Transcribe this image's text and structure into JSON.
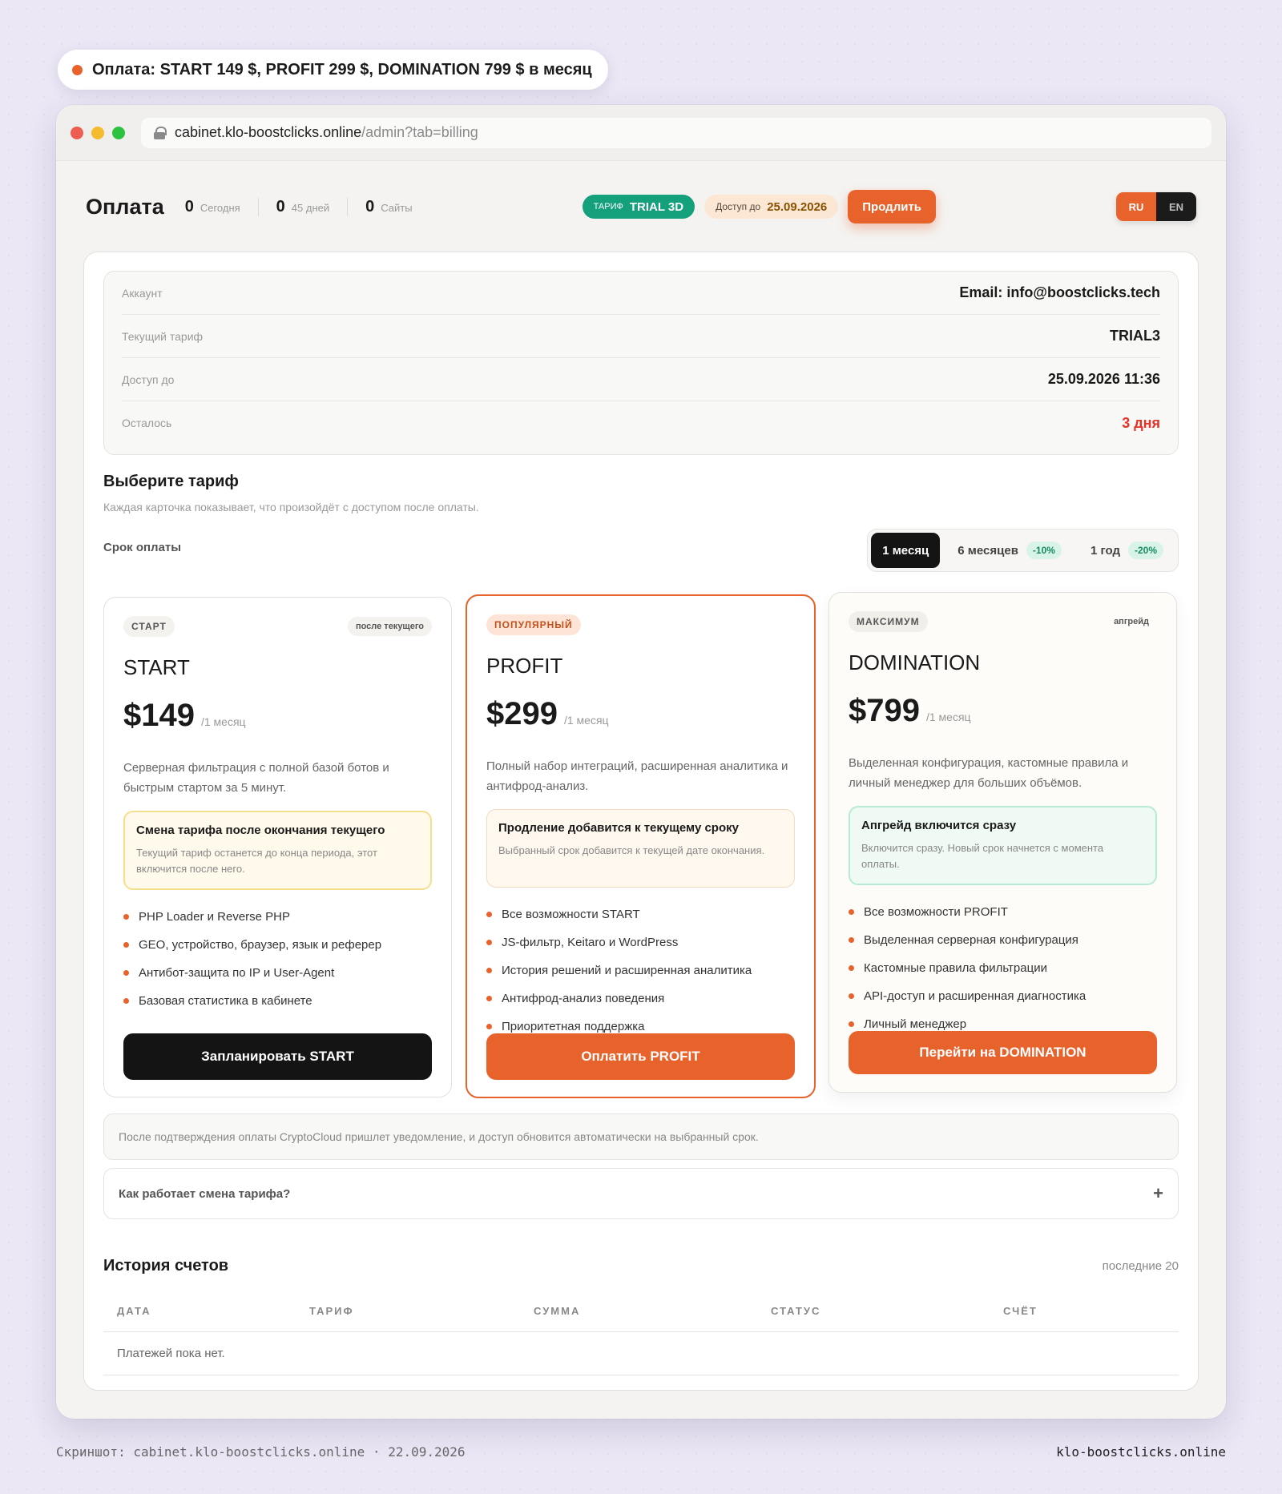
{
  "caption": "Оплата: START 149 $, PROFIT 299 $, DOMINATION 799 $ в месяц",
  "browser": {
    "url_host": "cabinet.klo-boostclicks.online",
    "url_path": "/admin?tab=billing"
  },
  "header": {
    "title": "Оплата",
    "stats": [
      {
        "value": "0",
        "label": "Сегодня"
      },
      {
        "value": "0",
        "label": "45 дней"
      },
      {
        "value": "0",
        "label": "Сайты"
      }
    ],
    "tariff_key": "ТАРИФ",
    "tariff_value": "TRIAL 3D",
    "access_key": "Доступ до",
    "access_value": "25.09.2026",
    "extend_label": "Продлить",
    "lang_ru": "RU",
    "lang_en": "EN"
  },
  "account": {
    "rows": [
      {
        "label": "Аккаунт",
        "value": "Email: info@boostclicks.tech"
      },
      {
        "label": "Текущий тариф",
        "value": "TRIAL3"
      },
      {
        "label": "Доступ до",
        "value": "25.09.2026 11:36"
      },
      {
        "label": "Осталось",
        "value": "3 дня"
      }
    ]
  },
  "plans_section": {
    "title": "Выберите тариф",
    "subtitle": "Каждая карточка показывает, что произойдёт с доступом после оплаты.",
    "period_label": "Срок оплаты",
    "periods": [
      {
        "label": "1 месяц",
        "discount": ""
      },
      {
        "label": "6 месяцев",
        "discount": "-10%"
      },
      {
        "label": "1 год",
        "discount": "-20%"
      }
    ]
  },
  "plans": [
    {
      "tag": "СТАРТ",
      "corner": "после текущего",
      "name": "START",
      "price": "$149",
      "per": "/1 месяц",
      "desc": "Серверная фильтрация с полной базой ботов и быстрым стартом за 5 минут.",
      "notice_title": "Смена тарифа после окончания текущего",
      "notice_text": "Текущий тариф останется до конца периода, этот включится после него.",
      "features": [
        "PHP Loader и Reverse PHP",
        "GEO, устройство, браузер, язык и реферер",
        "Антибот-защита по IP и User-Agent",
        "Базовая статистика в кабинете"
      ],
      "button": "Запланировать START"
    },
    {
      "tag": "ПОПУЛЯРНЫЙ",
      "corner": "",
      "name": "PROFIT",
      "price": "$299",
      "per": "/1 месяц",
      "desc": "Полный набор интеграций, расширенная аналитика и антифрод-анализ.",
      "notice_title": "Продление добавится к текущему сроку",
      "notice_text": "Выбранный срок добавится к текущей дате окончания.",
      "features": [
        "Все возможности START",
        "JS-фильтр, Keitaro и WordPress",
        "История решений и расширенная аналитика",
        "Антифрод-анализ поведения",
        "Приоритетная поддержка"
      ],
      "button": "Оплатить PROFIT"
    },
    {
      "tag": "МАКСИМУМ",
      "corner": "апгрейд",
      "name": "DOMINATION",
      "price": "$799",
      "per": "/1 месяц",
      "desc": "Выделенная конфигурация, кастомные правила и личный менеджер для больших объёмов.",
      "notice_title": "Апгрейд включится сразу",
      "notice_text": "Включится сразу. Новый срок начнется с момента оплаты.",
      "features": [
        "Все возможности PROFIT",
        "Выделенная серверная конфигурация",
        "Кастомные правила фильтрации",
        "API-доступ и расширенная диагностика",
        "Личный менеджер"
      ],
      "button": "Перейти на DOMINATION"
    }
  ],
  "payment_note": "После подтверждения оплаты CryptoCloud пришлет уведомление, и доступ обновится автоматически на выбранный срок.",
  "faq": {
    "title": "Как работает смена тарифа?",
    "icon": "+"
  },
  "history": {
    "title": "История счетов",
    "count": "последние 20",
    "columns": [
      "ДАТА",
      "ТАРИФ",
      "СУММА",
      "СТАТУС",
      "СЧЁТ"
    ],
    "empty": "Платежей пока нет."
  },
  "footer": {
    "left": "Скриншот: cabinet.klo-boostclicks.online · 22.09.2026",
    "right": "klo-boostclicks.online"
  },
  "colors": {
    "accent": "#e8622c",
    "success": "#13a07b",
    "danger": "#e0332a"
  }
}
